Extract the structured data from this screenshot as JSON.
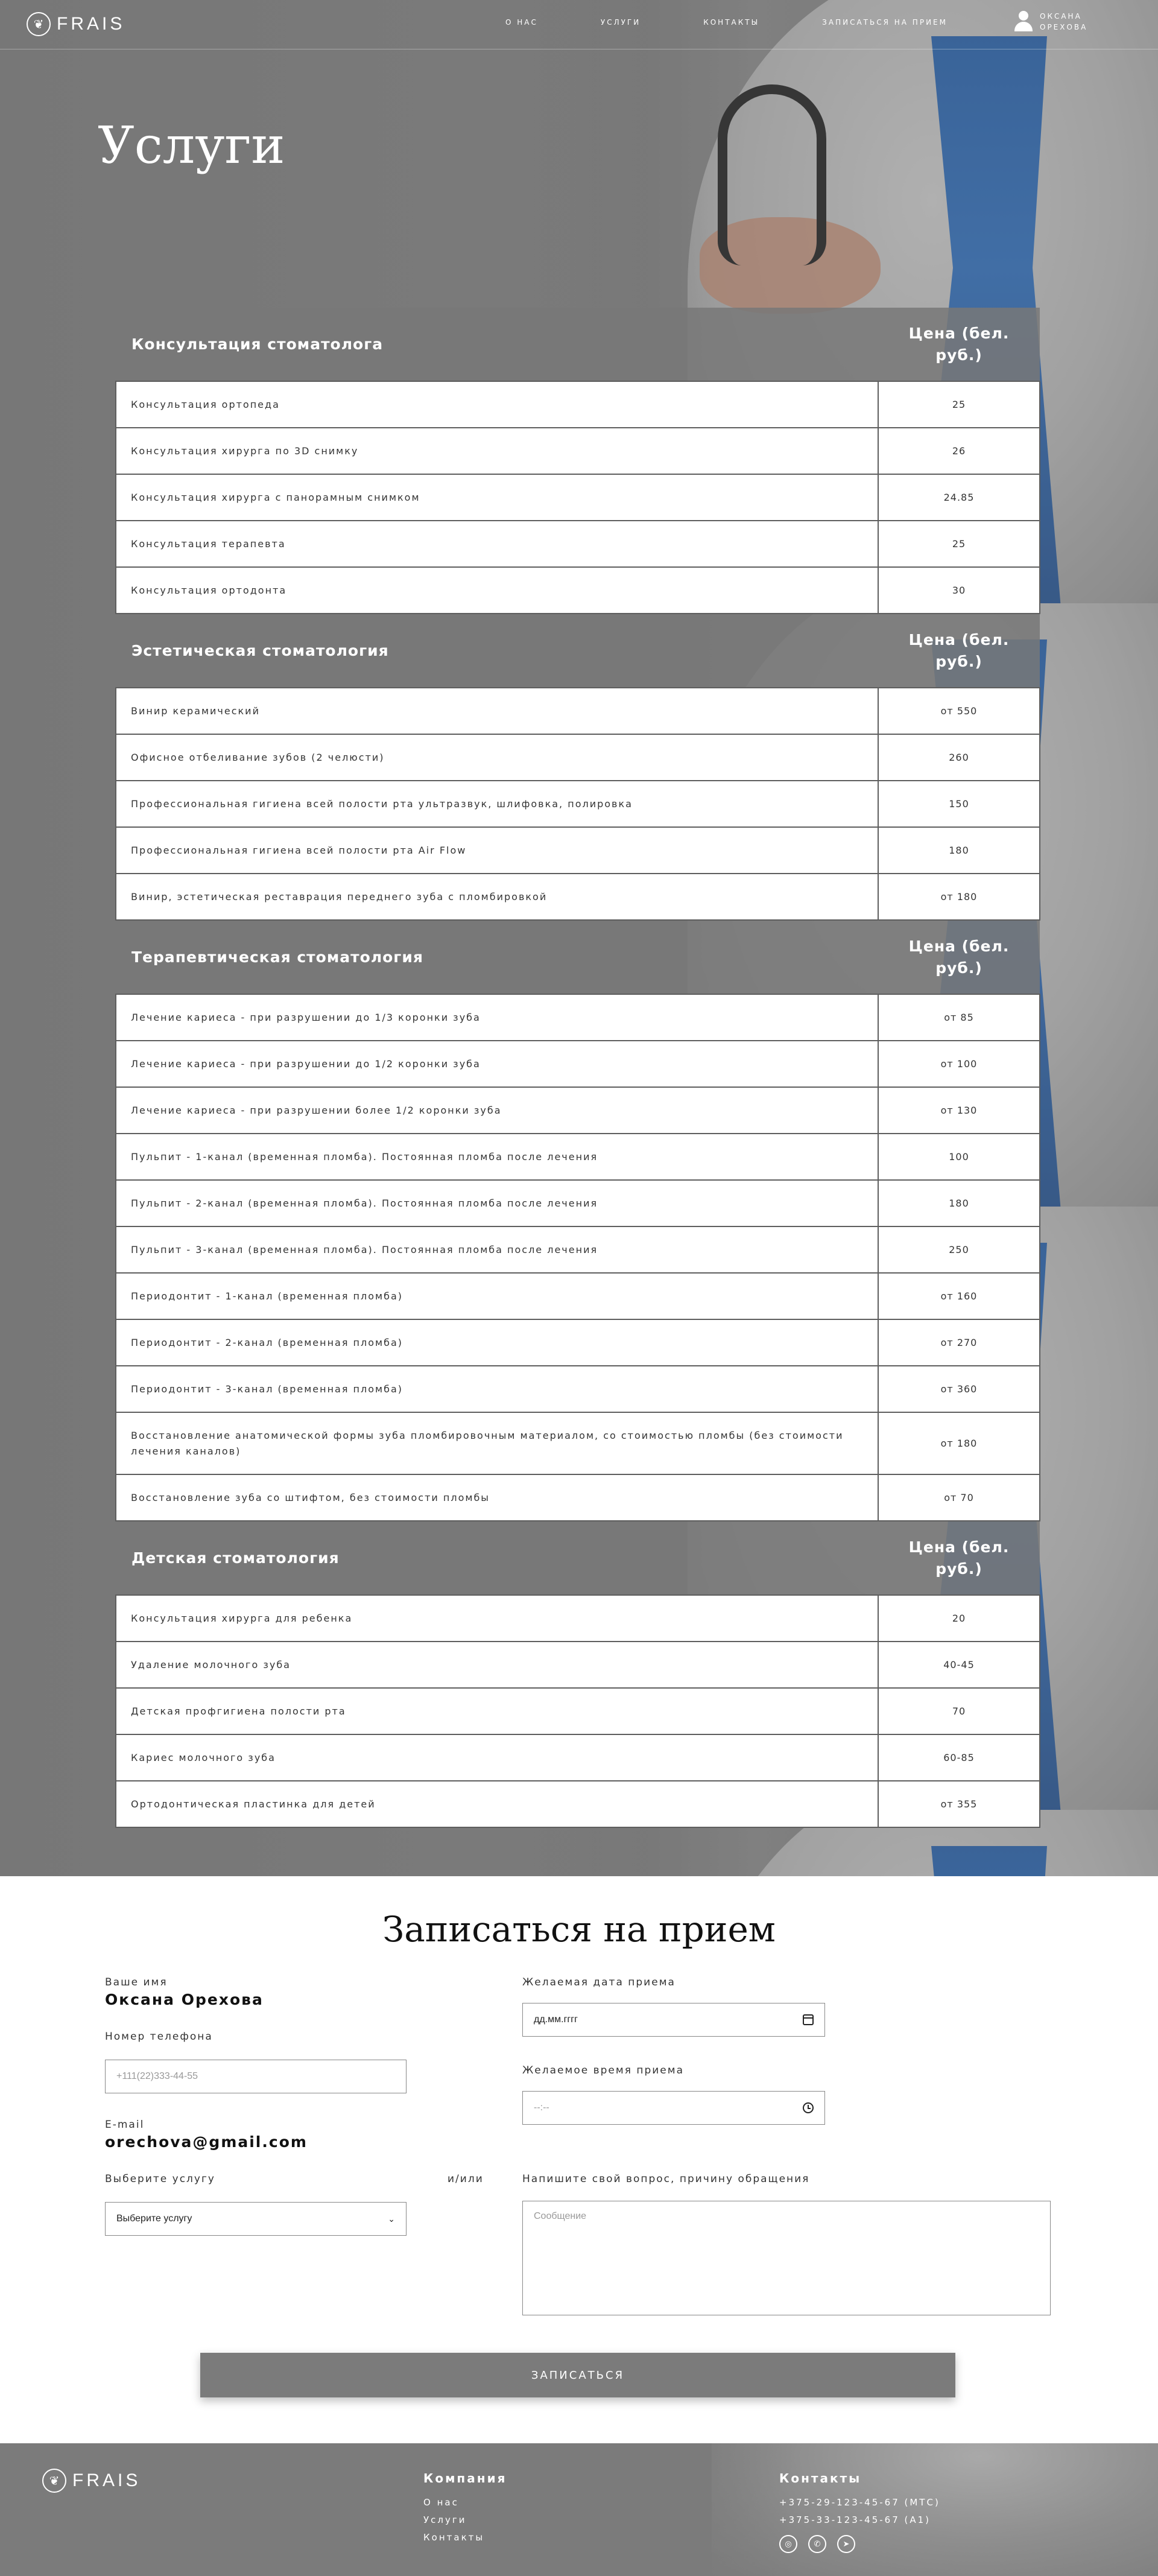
{
  "nav": {
    "logo": "FRAIS",
    "items": [
      "О НАС",
      "УСЛУГИ",
      "КОНТАКТЫ",
      "ЗАПИСАТЬСЯ НА ПРИЕМ"
    ],
    "user_line1": "ОКСАНА",
    "user_line2": "ОРЕХОВА"
  },
  "page_title": "Услуги",
  "price_header": "Цена (бел. руб.)",
  "sections": [
    {
      "title": "Консультация стоматолога",
      "rows": [
        [
          "Консультация ортопеда",
          "25"
        ],
        [
          "Консультация хирурга по 3D снимку",
          "26"
        ],
        [
          "Консультация хирурга с панорамным снимком",
          "24.85"
        ],
        [
          "Консультация терапевта",
          "25"
        ],
        [
          "Консультация ортодонта",
          "30"
        ]
      ]
    },
    {
      "title": "Эстетическая стоматология",
      "rows": [
        [
          "Винир керамический",
          "от 550"
        ],
        [
          "Офисное отбеливание зубов (2 челюсти)",
          "260"
        ],
        [
          "Профессиональная гигиена всей полости рта ультразвук, шлифовка, полировка",
          "150"
        ],
        [
          "Профессиональная гигиена всей полости рта Air Flow",
          "180"
        ],
        [
          "Винир, эстетическая реставрация переднего зуба с пломбировкой",
          "от 180"
        ]
      ]
    },
    {
      "title": "Терапевтическая стоматология",
      "rows": [
        [
          "Лечение кариеса - при разрушении до 1/3 коронки зуба",
          "от 85"
        ],
        [
          "Лечение кариеса - при разрушении до 1/2 коронки зуба",
          "от 100"
        ],
        [
          "Лечение кариеса - при разрушении более 1/2 коронки зуба",
          "от 130"
        ],
        [
          "Пульпит - 1-канал (временная пломба). Постоянная пломба после лечения",
          "100"
        ],
        [
          "Пульпит - 2-канал (временная пломба). Постоянная пломба после лечения",
          "180"
        ],
        [
          "Пульпит - 3-канал (временная пломба). Постоянная пломба после лечения",
          "250"
        ],
        [
          "Периодонтит - 1-канал (временная пломба)",
          "от 160"
        ],
        [
          "Периодонтит - 2-канал (временная пломба)",
          "от 270"
        ],
        [
          "Периодонтит - 3-канал (временная пломба)",
          "от 360"
        ],
        [
          "Восстановление анатомической формы зуба пломбировочным материалом, со стоимостью пломбы (без стоимости лечения каналов)",
          "от 180"
        ],
        [
          "Восстановление зуба со штифтом, без стоимости пломбы",
          "от 70"
        ]
      ]
    },
    {
      "title": "Детская стоматология",
      "rows": [
        [
          "Консультация хирурга для ребенка",
          "20"
        ],
        [
          "Удаление молочного зуба",
          "40-45"
        ],
        [
          "Детская профгигиена полости рта",
          "70"
        ],
        [
          "Кариес молочного зуба",
          "60-85"
        ],
        [
          "Ортодонтическая пластинка для детей",
          "от 355"
        ]
      ]
    }
  ],
  "form": {
    "title": "Записаться на прием",
    "name_label": "Ваше имя",
    "name_value": "Оксана Орехова",
    "phone_label": "Номер телефона",
    "phone_placeholder": "+111(22)333-44-55",
    "email_label": "E-mail",
    "email_value": "orechova@gmail.com",
    "service_label": "Выберите услугу",
    "service_selected": "Выберите услугу",
    "or_text": "и/или",
    "date_label": "Желаемая дата приема",
    "date_placeholder": "дд.мм.гггг",
    "time_label": "Желаемое время приема",
    "time_placeholder": "--:--",
    "message_label": "Напишите свой вопрос, причину обращения",
    "message_placeholder": "Сообщение",
    "submit": "ЗАПИСАТЬСЯ"
  },
  "footer": {
    "logo": "FRAIS",
    "company_title": "Компания",
    "company_links": [
      "О нас",
      "Услуги",
      "Контакты"
    ],
    "contacts_title": "Контакты",
    "phones": [
      "+375-29-123-45-67 (МТС)",
      "+375-33-123-45-67 (А1)"
    ],
    "socials": [
      "instagram-icon",
      "viber-icon",
      "telegram-icon"
    ]
  },
  "colors": {
    "header_gray": "#7b7b7b",
    "accent_blue": "#2a6fc4",
    "white": "#ffffff"
  }
}
